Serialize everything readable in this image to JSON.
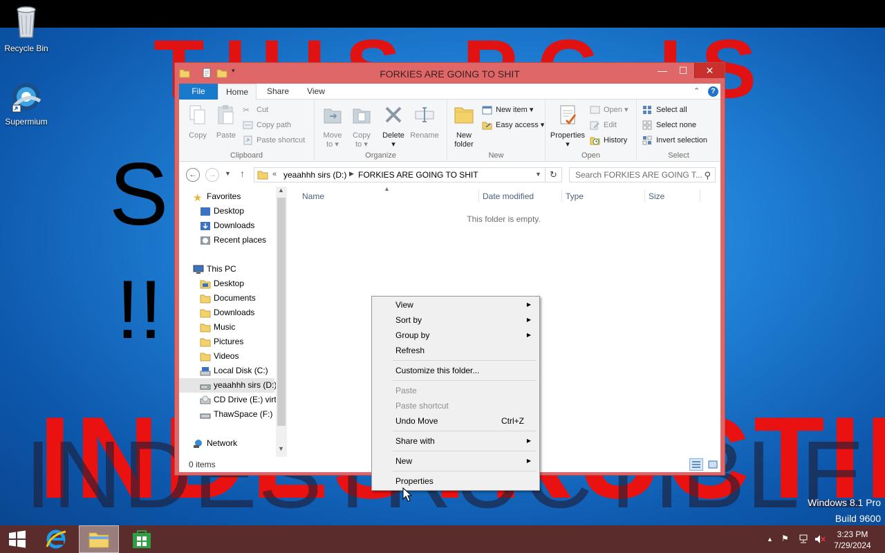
{
  "desktop": {
    "wallpaper_text": {
      "top": "THIS PC IS",
      "middle_s": "S",
      "middle_bang": "!!",
      "bottom_red": "INDESTRUCTIBLE",
      "bottom_dark": "INDESTRUCTIBLE"
    },
    "icons": [
      {
        "label": "Recycle Bin",
        "icon": "recycle-bin-icon"
      },
      {
        "label": "Supermium",
        "icon": "supermium-icon"
      }
    ],
    "watermark": [
      "Windows 8.1 Pro",
      "Build 9600"
    ]
  },
  "window": {
    "title": "FORKIES ARE GOING TO SHIT",
    "controls": {
      "minimize": "—",
      "maximize": "☐",
      "close": "✕"
    },
    "colors": {
      "frame": "#e06767",
      "close": "#c9302c",
      "accent": "#1979ca"
    }
  },
  "ribbon": {
    "tabs": [
      "File",
      "Home",
      "Share",
      "View"
    ],
    "clipboard": {
      "label": "Clipboard",
      "copy": "Copy",
      "paste": "Paste",
      "cut": "Cut",
      "copy_path": "Copy path",
      "paste_shortcut": "Paste shortcut"
    },
    "organize": {
      "label": "Organize",
      "move_to": [
        "Move",
        "to ▾"
      ],
      "copy_to": [
        "Copy",
        "to ▾"
      ],
      "delete": [
        "Delete",
        "▾"
      ],
      "rename": "Rename"
    },
    "new": {
      "label": "New",
      "new_folder": [
        "New",
        "folder"
      ],
      "new_item": "New item ▾",
      "easy_access": "Easy access ▾"
    },
    "open": {
      "label": "Open",
      "properties": [
        "Properties",
        "▾"
      ],
      "open": "Open ▾",
      "edit": "Edit",
      "history": "History"
    },
    "select": {
      "label": "Select",
      "select_all": "Select all",
      "select_none": "Select none",
      "invert_selection": "Invert selection"
    }
  },
  "address": {
    "chevrons": "«",
    "crumbs": [
      "yeaahhh sirs (D:)",
      "FORKIES ARE GOING TO SHIT"
    ],
    "search_placeholder": "Search FORKIES ARE GOING T..."
  },
  "nav_pane": {
    "favorites": {
      "label": "Favorites",
      "items": [
        "Desktop",
        "Downloads",
        "Recent places"
      ]
    },
    "this_pc": {
      "label": "This PC",
      "items": [
        "Desktop",
        "Documents",
        "Downloads",
        "Music",
        "Pictures",
        "Videos",
        "Local Disk (C:)",
        "yeaahhh sirs (D:)",
        "CD Drive (E:) virti",
        "ThawSpace (F:)"
      ]
    },
    "network": "Network",
    "selected": "yeaahhh sirs (D:)"
  },
  "content": {
    "columns": [
      "Name",
      "Date modified",
      "Type",
      "Size"
    ],
    "empty_message": "This folder is empty."
  },
  "status": {
    "item_count": "0 items"
  },
  "context_menu": {
    "items": [
      {
        "label": "View",
        "submenu": true
      },
      {
        "label": "Sort by",
        "submenu": true
      },
      {
        "label": "Group by",
        "submenu": true
      },
      {
        "label": "Refresh"
      },
      {
        "label": "Customize this folder..."
      },
      {
        "label": "Paste",
        "disabled": true
      },
      {
        "label": "Paste shortcut",
        "disabled": true
      },
      {
        "label": "Undo Move",
        "shortcut": "Ctrl+Z"
      },
      {
        "label": "Share with",
        "submenu": true
      },
      {
        "label": "New",
        "submenu": true
      },
      {
        "label": "Properties"
      }
    ],
    "submenu_arrow": "▶"
  },
  "taskbar": {
    "pinned": [
      "start-icon",
      "internet-explorer-icon",
      "file-explorer-icon",
      "store-icon"
    ],
    "clock": {
      "time": "3:23 PM",
      "date": "7/29/2024"
    },
    "tray": {
      "chevron": "▲"
    },
    "color": "#5b2c2c"
  }
}
